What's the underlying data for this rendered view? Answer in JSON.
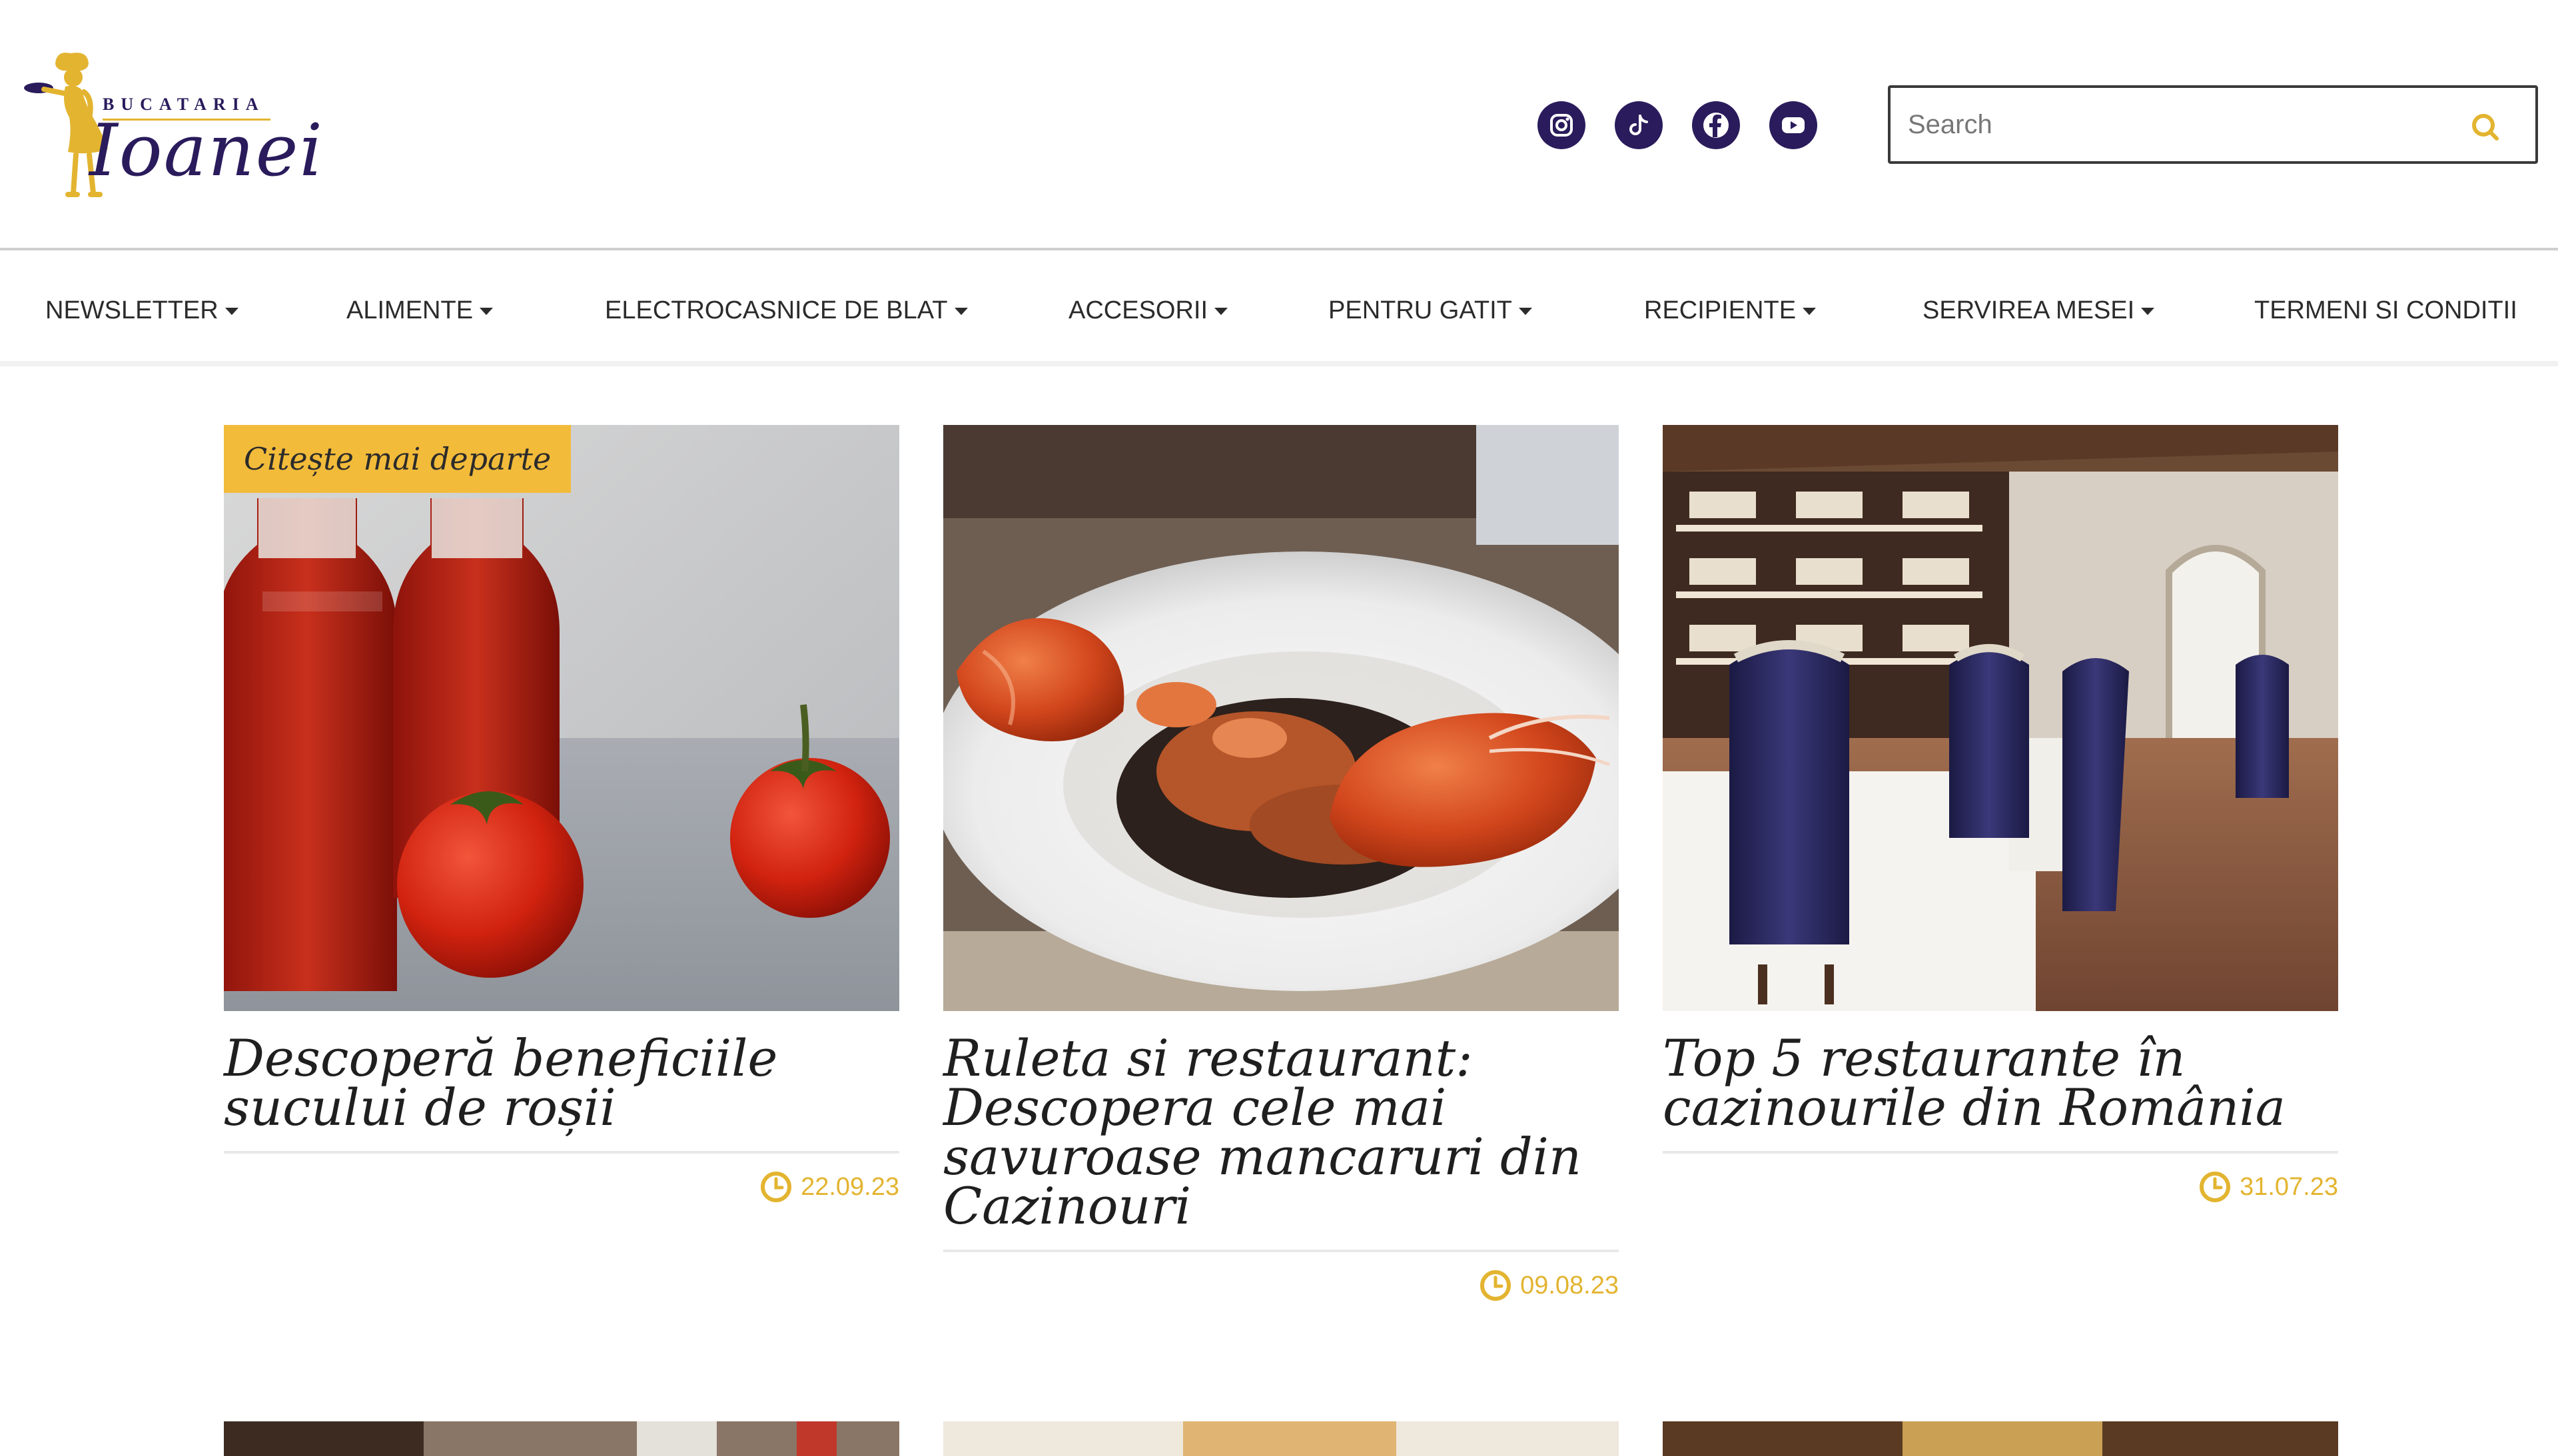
{
  "brand": {
    "top_word": "BUCATARIA",
    "script_word": "Ioanei",
    "accent_color": "#e3b430",
    "primary_color": "#2a1b5c"
  },
  "socials": [
    {
      "name": "instagram-icon"
    },
    {
      "name": "tiktok-icon"
    },
    {
      "name": "facebook-icon"
    },
    {
      "name": "youtube-icon"
    }
  ],
  "search": {
    "placeholder": "Search",
    "value": ""
  },
  "nav": {
    "items": [
      {
        "label": "NEWSLETTER",
        "dropdown": true
      },
      {
        "label": "ALIMENTE",
        "dropdown": true
      },
      {
        "label": "ELECTROCASNICE DE BLAT",
        "dropdown": true
      },
      {
        "label": "ACCESORII",
        "dropdown": true
      },
      {
        "label": "PENTRU GATIT",
        "dropdown": true
      },
      {
        "label": "RECIPIENTE",
        "dropdown": true
      },
      {
        "label": "SERVIREA MESEI",
        "dropdown": true
      },
      {
        "label": "TERMENI SI CONDITII",
        "dropdown": false
      }
    ]
  },
  "cards": [
    {
      "ribbon": "Citește mai departe",
      "title": "Descoperă beneficiile sucului de roșii",
      "date": "22.09.23"
    },
    {
      "title": "Ruleta si restaurant: Descopera cele mai savuroase mancaruri din Cazinouri",
      "date": "09.08.23"
    },
    {
      "title": "Top 5 restaurante în cazinourile din România",
      "date": "31.07.23"
    }
  ]
}
